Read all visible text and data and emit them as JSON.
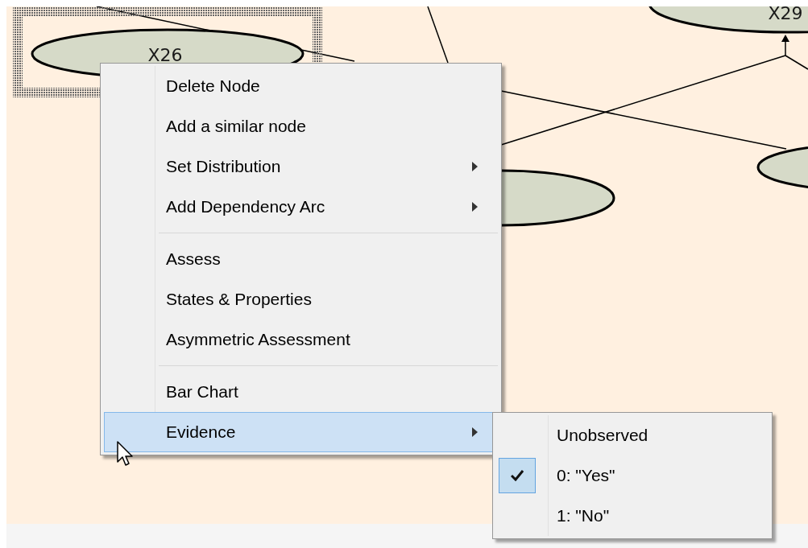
{
  "canvas": {
    "nodes": [
      {
        "label": "X26",
        "selected": true
      },
      {
        "label": "X29",
        "selected": false
      },
      {
        "selected": false
      },
      {
        "selected": false
      }
    ]
  },
  "context_menu": {
    "items": [
      {
        "kind": "item",
        "label": "Delete Node",
        "submenu": false,
        "highlighted": false
      },
      {
        "kind": "item",
        "label": "Add a similar node",
        "submenu": false,
        "highlighted": false
      },
      {
        "kind": "item",
        "label": "Set Distribution",
        "submenu": true,
        "highlighted": false
      },
      {
        "kind": "item",
        "label": "Add Dependency Arc",
        "submenu": true,
        "highlighted": false
      },
      {
        "kind": "separator"
      },
      {
        "kind": "item",
        "label": "Assess",
        "submenu": false,
        "highlighted": false
      },
      {
        "kind": "item",
        "label": "States & Properties",
        "submenu": false,
        "highlighted": false
      },
      {
        "kind": "item",
        "label": "Asymmetric Assessment",
        "submenu": false,
        "highlighted": false
      },
      {
        "kind": "separator"
      },
      {
        "kind": "item",
        "label": "Bar Chart",
        "submenu": false,
        "highlighted": false
      },
      {
        "kind": "item",
        "label": "Evidence",
        "submenu": true,
        "highlighted": true
      }
    ]
  },
  "evidence_submenu": {
    "items": [
      {
        "label": "Unobserved",
        "checked": false
      },
      {
        "label": "0: \"Yes\"",
        "checked": true
      },
      {
        "label": "1: \"No\"",
        "checked": false
      }
    ]
  }
}
